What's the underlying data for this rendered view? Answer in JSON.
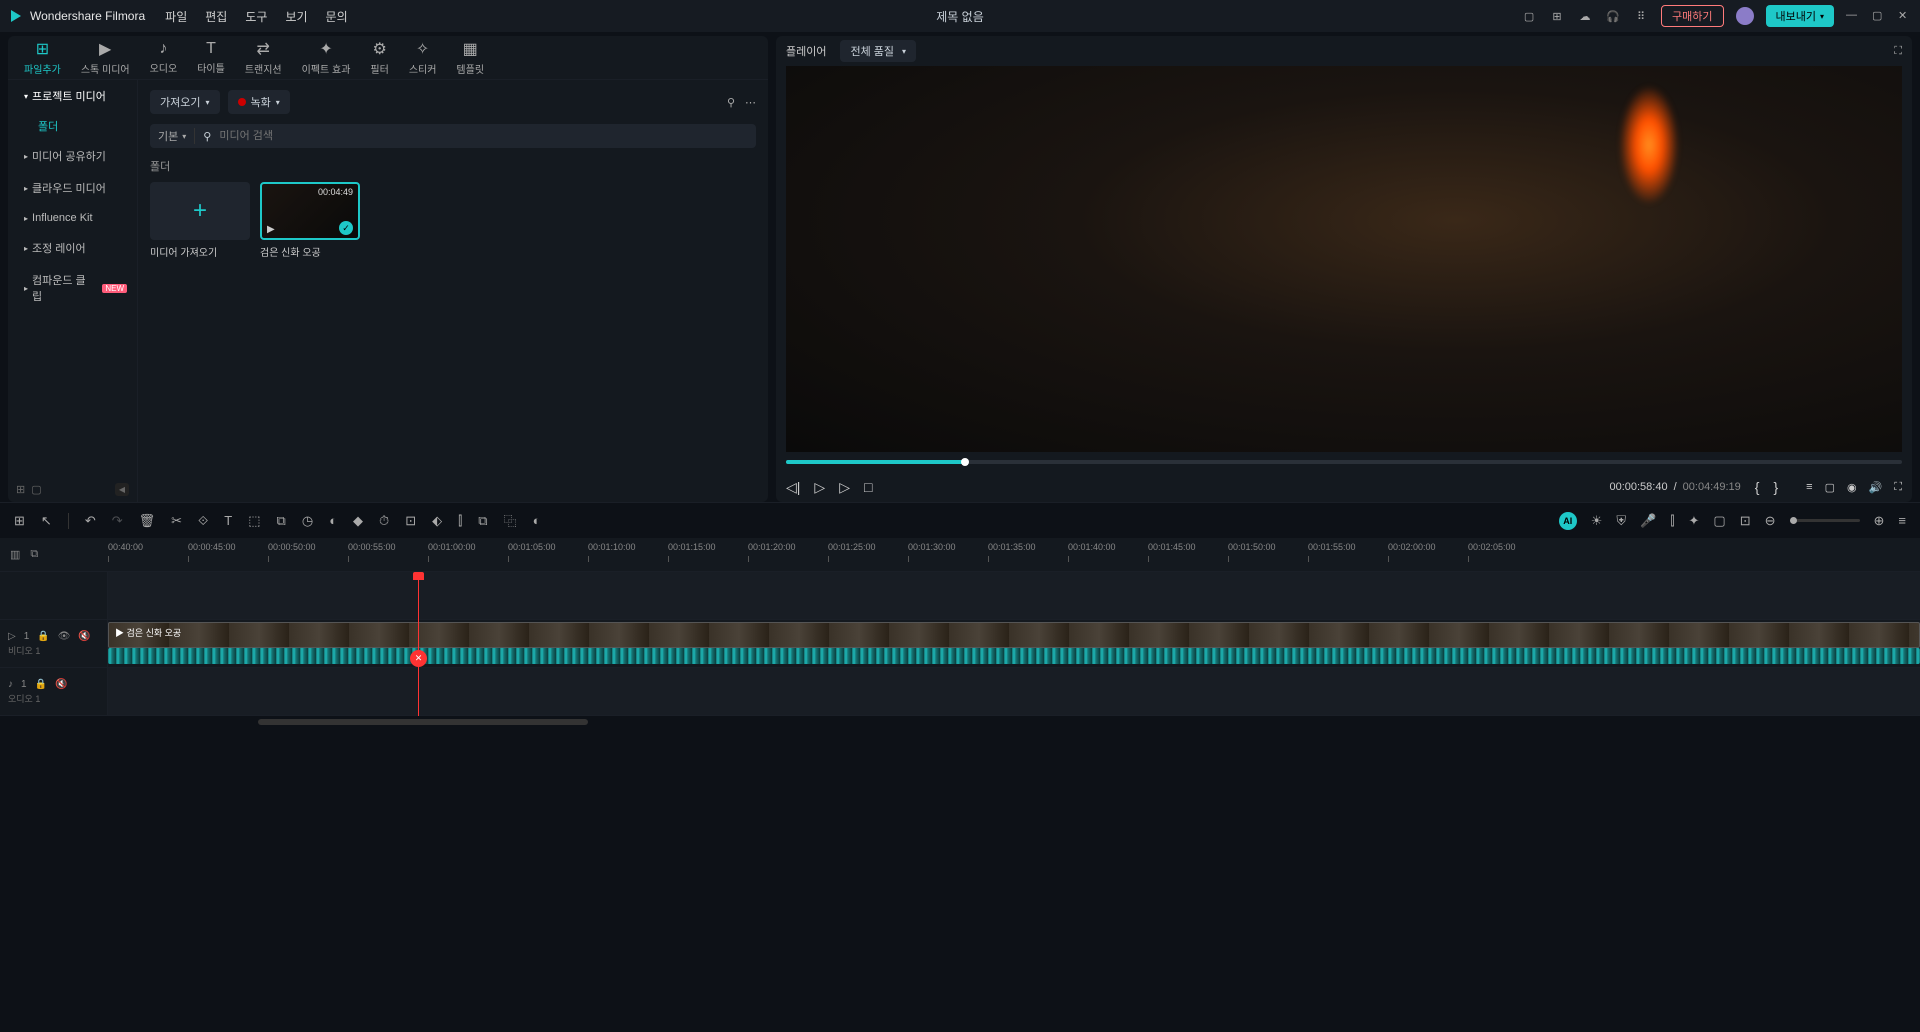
{
  "app": {
    "name": "Wondershare Filmora",
    "doc_title": "제목 없음"
  },
  "menus": [
    "파일",
    "편집",
    "도구",
    "보기",
    "문의"
  ],
  "titlebar_buttons": {
    "buy": "구매하기",
    "export": "내보내기"
  },
  "media_tabs": [
    {
      "label": "파일추가",
      "active": true
    },
    {
      "label": "스톡 미디어"
    },
    {
      "label": "오디오"
    },
    {
      "label": "타이틀"
    },
    {
      "label": "트랜지션"
    },
    {
      "label": "이펙트 효과"
    },
    {
      "label": "필터"
    },
    {
      "label": "스티커"
    },
    {
      "label": "템플릿"
    }
  ],
  "sidebar": {
    "items": [
      {
        "label": "프로젝트 미디어",
        "sub": "폴더",
        "active": true
      },
      {
        "label": "미디어 공유하기"
      },
      {
        "label": "클라우드 미디어"
      },
      {
        "label": "Influence Kit"
      },
      {
        "label": "조정 레이어"
      },
      {
        "label": "컴파운드 클립",
        "badge": "NEW"
      }
    ]
  },
  "media_toolbar": {
    "import": "가져오기",
    "record": "녹화"
  },
  "media_search": {
    "base": "기본",
    "placeholder": "미디어 검색"
  },
  "folder_label": "폴더",
  "media_cards": {
    "add": {
      "name": "미디어 가져오기"
    },
    "video": {
      "name": "검은 신화 오공",
      "duration": "00:04:49"
    }
  },
  "player": {
    "label": "플레이어",
    "quality": "전체 품질",
    "current_time": "00:00:58:40",
    "sep": "/",
    "total_time": "00:04:49:19"
  },
  "ruler_ticks": [
    "00:40:00",
    "00:00:45:00",
    "00:00:50:00",
    "00:00:55:00",
    "00:01:00:00",
    "00:01:05:00",
    "00:01:10:00",
    "00:01:15:00",
    "00:01:20:00",
    "00:01:25:00",
    "00:01:30:00",
    "00:01:35:00",
    "00:01:40:00",
    "00:01:45:00",
    "00:01:50:00",
    "00:01:55:00",
    "00:02:00:00",
    "00:02:05:00"
  ],
  "tracks": {
    "video": {
      "label": "비디오 1",
      "clip_name": "검은 신화 오공"
    },
    "audio": {
      "label": "오디오 1"
    }
  }
}
